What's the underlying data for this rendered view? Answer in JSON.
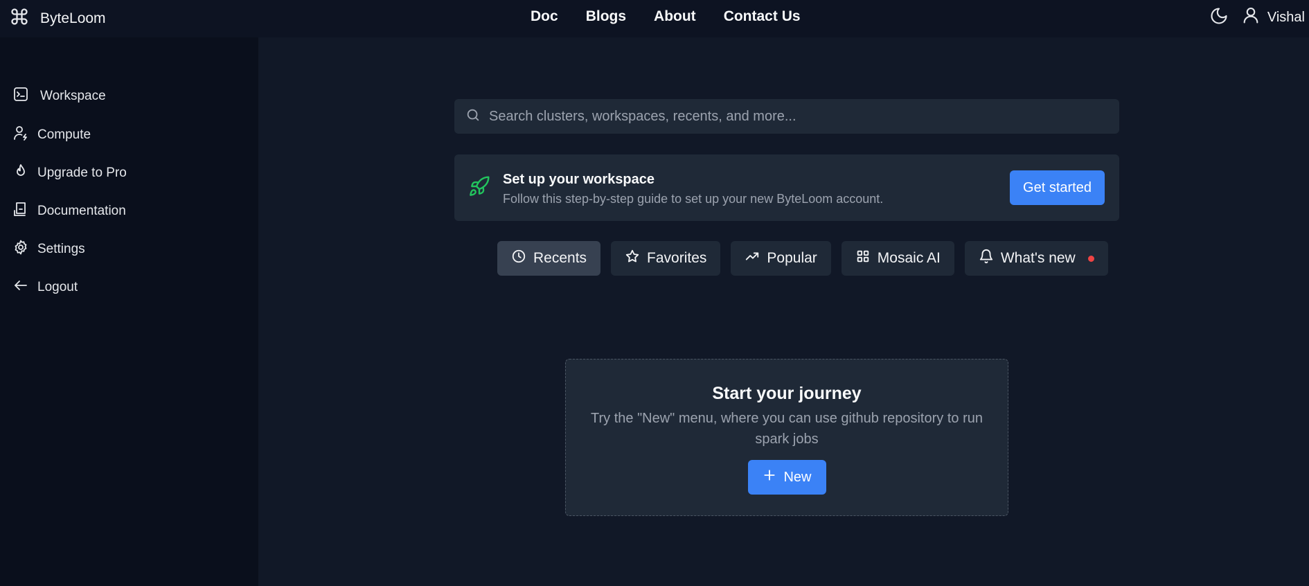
{
  "header": {
    "brand": "ByteLoom",
    "nav": [
      "Doc",
      "Blogs",
      "About",
      "Contact Us"
    ],
    "user_name": "Vishal"
  },
  "sidebar": {
    "items": [
      {
        "label": "Workspace",
        "icon": "terminal-icon"
      },
      {
        "label": "Compute",
        "icon": "user-bolt-icon"
      },
      {
        "label": "Upgrade to Pro",
        "icon": "flame-icon"
      },
      {
        "label": "Documentation",
        "icon": "document-icon"
      },
      {
        "label": "Settings",
        "icon": "gear-icon"
      },
      {
        "label": "Logout",
        "icon": "arrow-left-icon"
      }
    ]
  },
  "search": {
    "placeholder": "Search clusters, workspaces, recents, and more..."
  },
  "setup": {
    "title": "Set up your workspace",
    "description": "Follow this step-by-step guide to set up your new ByteLoom account.",
    "button": "Get started"
  },
  "tabs": [
    {
      "label": "Recents",
      "icon": "clock-icon",
      "active": true
    },
    {
      "label": "Favorites",
      "icon": "star-icon"
    },
    {
      "label": "Popular",
      "icon": "trending-up-icon"
    },
    {
      "label": "Mosaic AI",
      "icon": "grid-icon"
    },
    {
      "label": "What's new",
      "icon": "bell-icon",
      "badge": true
    }
  ],
  "journey": {
    "title": "Start your journey",
    "description": "Try the \"New\" menu, where you can use github repository to run spark jobs",
    "button": "New"
  },
  "colors": {
    "accent": "#3b82f6",
    "badge": "#ef4444",
    "rocket": "#22c55e",
    "background": "#111827",
    "sidebar": "#0a0f1c"
  }
}
